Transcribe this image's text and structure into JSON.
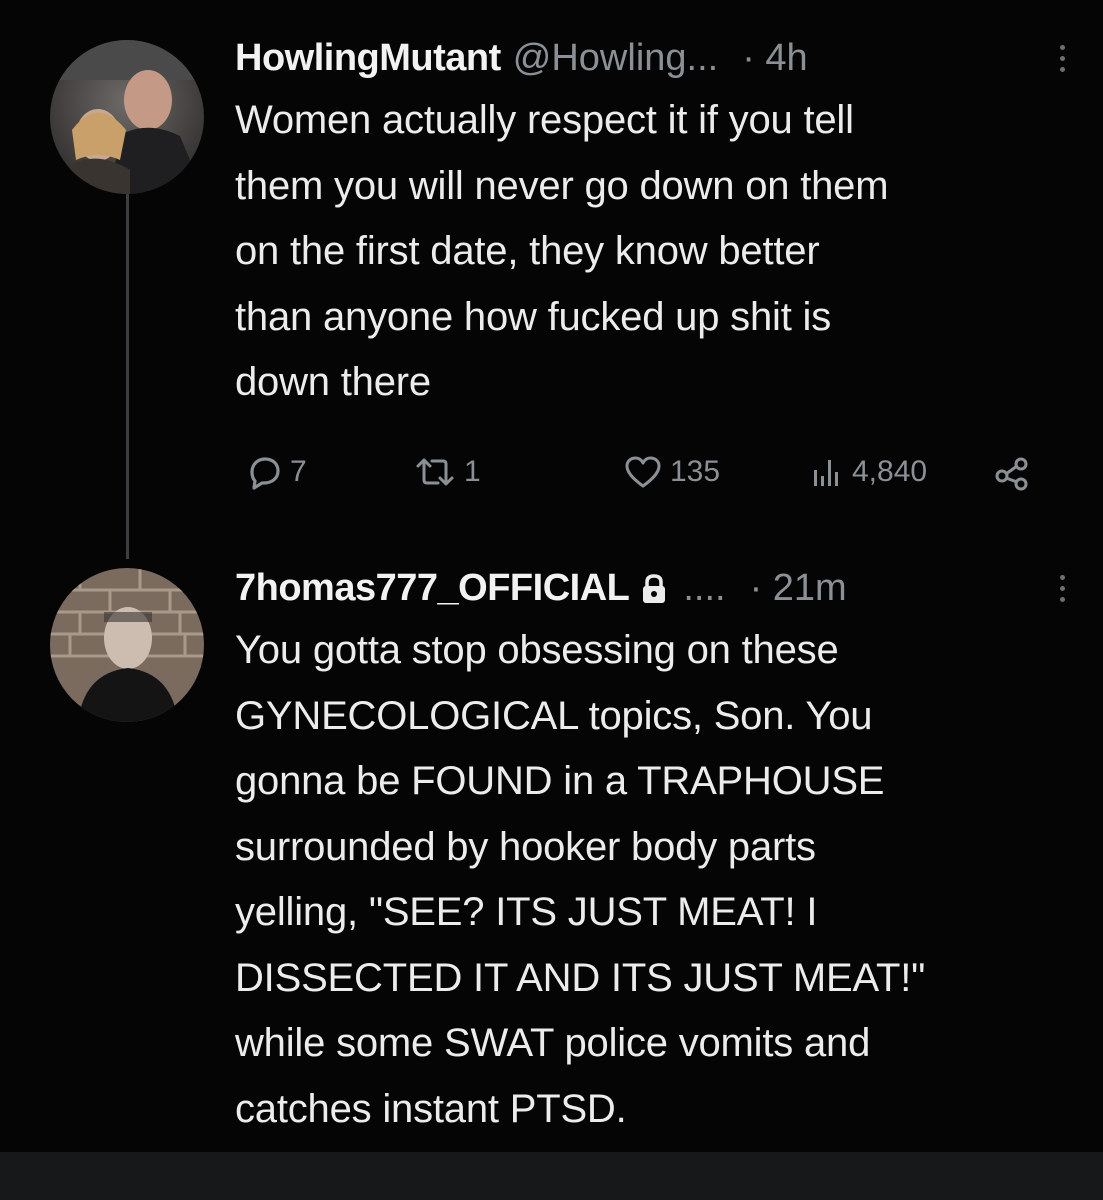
{
  "thread": {
    "tweets": [
      {
        "display_name": "HowlingMutant",
        "handle": "@Howling...",
        "time": "· 4h",
        "lines": [
          "Women actually respect it if you tell",
          "them you will never go down on them",
          "on the first date, they know better",
          "than anyone how fucked up shit is",
          "down there"
        ],
        "actions": {
          "replies": "7",
          "retweets": "1",
          "likes": "135",
          "views": "4,840"
        },
        "icons": {
          "avatar": "profile-photo-avatar",
          "more": "more-vertical-icon",
          "reply": "reply-bubble-icon",
          "retweet": "retweet-icon",
          "like": "heart-icon",
          "views": "views-bar-chart-icon",
          "share": "share-icon"
        }
      },
      {
        "display_name": "7homas777_OFFICIAL",
        "handle": "....",
        "time": "· 21m",
        "lines": [
          "You gotta stop obsessing on these",
          "GYNECOLOGICAL topics, Son. You",
          "gonna be FOUND in a TRAPHOUSE",
          "surrounded by hooker body parts",
          "yelling, \"SEE? ITS JUST MEAT! I",
          "DISSECTED IT AND ITS JUST MEAT!\"",
          "while some SWAT police vomits and",
          "catches instant PTSD."
        ],
        "icons": {
          "avatar": "profile-photo-avatar",
          "lock": "lock-icon",
          "more": "more-vertical-icon"
        }
      }
    ]
  },
  "colors": {
    "background": "#050505",
    "text": "#ececec",
    "muted": "#8b9096",
    "thread_line": "#3b3f43"
  }
}
